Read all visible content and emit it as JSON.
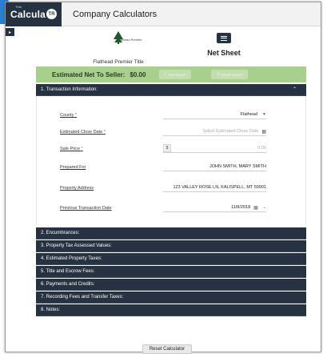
{
  "app": {
    "logo_pre": "Title",
    "logo_text": "Calcula",
    "logo_badge": "TR",
    "title": "Company Calculators"
  },
  "header": {
    "brand_logo_text": "Flathead Premier",
    "brand_caption": "Flathead Premier Title",
    "sheet_title": "Net Sheet"
  },
  "summary": {
    "label": "Estimated Net To Seller:",
    "value": "$0.00",
    "get_report_label": "Get Report",
    "email_report_label": "Email Report"
  },
  "transaction": {
    "heading": "1. Transaction Information:",
    "fields": {
      "county": {
        "label": "County",
        "required": "*",
        "value": "Flathead"
      },
      "close_date": {
        "label": "Estimated Close Date",
        "required": "*",
        "placeholder": "Select Estimated Close Date"
      },
      "sale_price": {
        "label": "Sale Price",
        "required": "*",
        "prefix": "$",
        "placeholder": "0.00"
      },
      "prepared_for": {
        "label": "Prepared For",
        "value": "JOHN SMITH, MARY SMITH"
      },
      "property_address": {
        "label": "Property Address",
        "value": "123 VALLEY ROSE LN, KALISPELL, MT 59901"
      },
      "previous_date": {
        "label": "Previous Transaction Date",
        "value": "11/8/2018"
      }
    }
  },
  "sections": [
    "2. Encumbrances:",
    "3. Property Tax Assessed Values:",
    "4. Estimated Property Taxes:",
    "5. Title and Escrow Fees:",
    "6. Payments and Credits:",
    "7. Recording Fees and Transfer Taxes:",
    "8. Notes:"
  ],
  "footer": {
    "reset_label": "Reset Calculator"
  },
  "colors": {
    "navy": "#263241",
    "green": "#a8d08d",
    "accent_blue": "#2a7fd4",
    "required_red": "#d9534f"
  },
  "icons": {
    "expand": "chevron-up-icon",
    "calendar": "calendar-icon",
    "menu": "hamburger-icon"
  }
}
